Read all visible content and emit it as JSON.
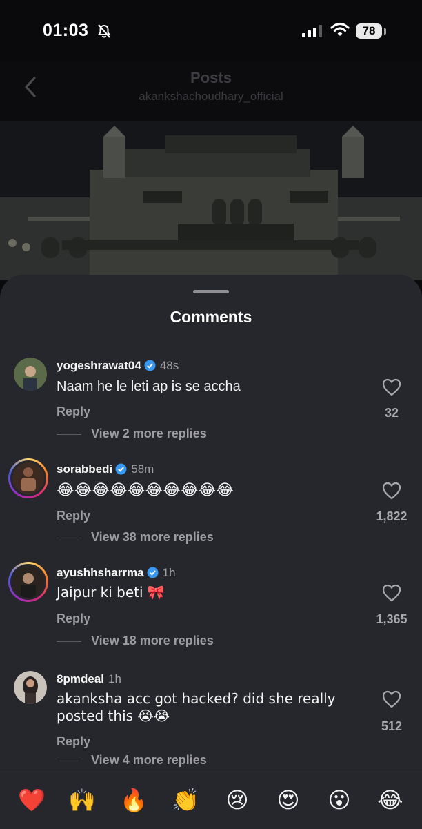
{
  "status_bar": {
    "time": "01:03",
    "battery": "78",
    "icons": [
      "bell-slash-icon",
      "signal-icon",
      "wifi-icon",
      "battery-icon"
    ]
  },
  "header": {
    "title": "Posts",
    "subtitle": "akankshachoudhary_official",
    "back_icon": "chevron-left-icon"
  },
  "sheet": {
    "title": "Comments"
  },
  "comments": [
    {
      "username": "yogeshrawat04",
      "verified": true,
      "time": "48s",
      "text": "Naam he le leti ap is se accha",
      "reply": "Reply",
      "more_replies": "View 2 more replies",
      "likes": "32",
      "ring": false
    },
    {
      "username": "sorabbedi",
      "verified": true,
      "time": "58m",
      "text": "😂😂😂😂😂😂😂😂😂😂",
      "reply": "Reply",
      "more_replies": "View 38 more replies",
      "likes": "1,822",
      "ring": true
    },
    {
      "username": "ayushhsharrma",
      "verified": true,
      "time": "1h",
      "text": "Jaipur ki beti 🎀",
      "reply": "Reply",
      "more_replies": "View 18 more replies",
      "likes": "1,365",
      "ring": true
    },
    {
      "username": "8pmdeal",
      "verified": false,
      "time": "1h",
      "text": "akanksha acc got hacked? did she really posted this 😭😭",
      "reply": "Reply",
      "more_replies": "View 4 more replies",
      "likes": "512",
      "ring": false
    }
  ],
  "reactions": [
    "❤️",
    "🙌",
    "🔥",
    "👏",
    "😢",
    "😍",
    "😮",
    "😂"
  ],
  "colors": {
    "sheet_bg": "#25272c",
    "verified": "#3897f0",
    "muted": "#9c9ca1"
  }
}
